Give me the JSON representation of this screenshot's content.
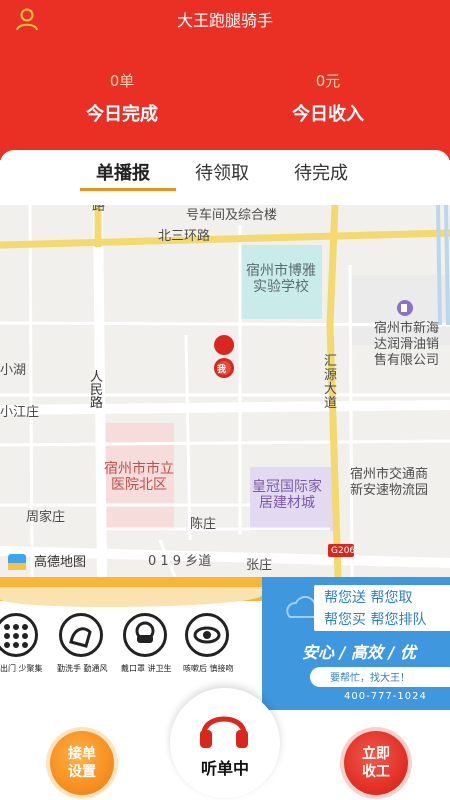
{
  "header": {
    "title": "大王跑腿骑手",
    "stats": [
      {
        "value": "0单",
        "label": "今日完成"
      },
      {
        "value": "0元",
        "label": "今日收入"
      }
    ]
  },
  "tabs": [
    {
      "label": "单播报",
      "active": true
    },
    {
      "label": "待领取",
      "active": false
    },
    {
      "label": "待完成",
      "active": false
    }
  ],
  "map": {
    "labels": {
      "top_road": "路",
      "workshop": "号车间及综合楼",
      "ring_road": "北三环路",
      "school": "宿州市博雅\n实验学校",
      "gas": "宿州市新海\n达润滑油销\n售有限公司",
      "lake": "小湖",
      "renmin": "人\n民\n路",
      "xiaojiang": "小江庄",
      "huiyuan": "汇\n源\n大\n道",
      "me": "我",
      "hospital": "宿州市市立\n医院北区",
      "logistics": "宿州市交通商\n新安速物流园",
      "furniture": "皇冠国际家\n居建材城",
      "zhoujia": "周家庄",
      "chenzhuang": "陈庄",
      "road_019": "0 1 9 乡道",
      "zhangzhuang": "张庄",
      "g206": "G206",
      "amap": "高德地图"
    }
  },
  "banner_left": {
    "items": [
      {
        "text": "少出门 少聚集"
      },
      {
        "text": "勤洗手 勤通风"
      },
      {
        "text": "戴口罩 讲卫生"
      },
      {
        "text": "咳嗽后 慎接吻"
      }
    ]
  },
  "banner_right": {
    "line1": "帮您送  帮您取",
    "line2": "帮您买  帮您排队",
    "slogan": "安心 / 高效 / 优",
    "pill": "要帮忙，找大王！",
    "phone": "400-777-1024"
  },
  "bottom": {
    "left_button": "接单\n设置",
    "center_label": "听单中",
    "right_button": "立即\n收工"
  },
  "colors": {
    "header_red": "#ea2f24",
    "tab_accent": "#e8941c",
    "orange_button": "#f58a1a",
    "red_button": "#e02b21",
    "banner_blue": "#3f97de"
  },
  "icons": {
    "user": "user-outline-icon",
    "headphones": "headphones-icon",
    "location": "location-pin-icon",
    "gas": "gas-station-icon"
  }
}
